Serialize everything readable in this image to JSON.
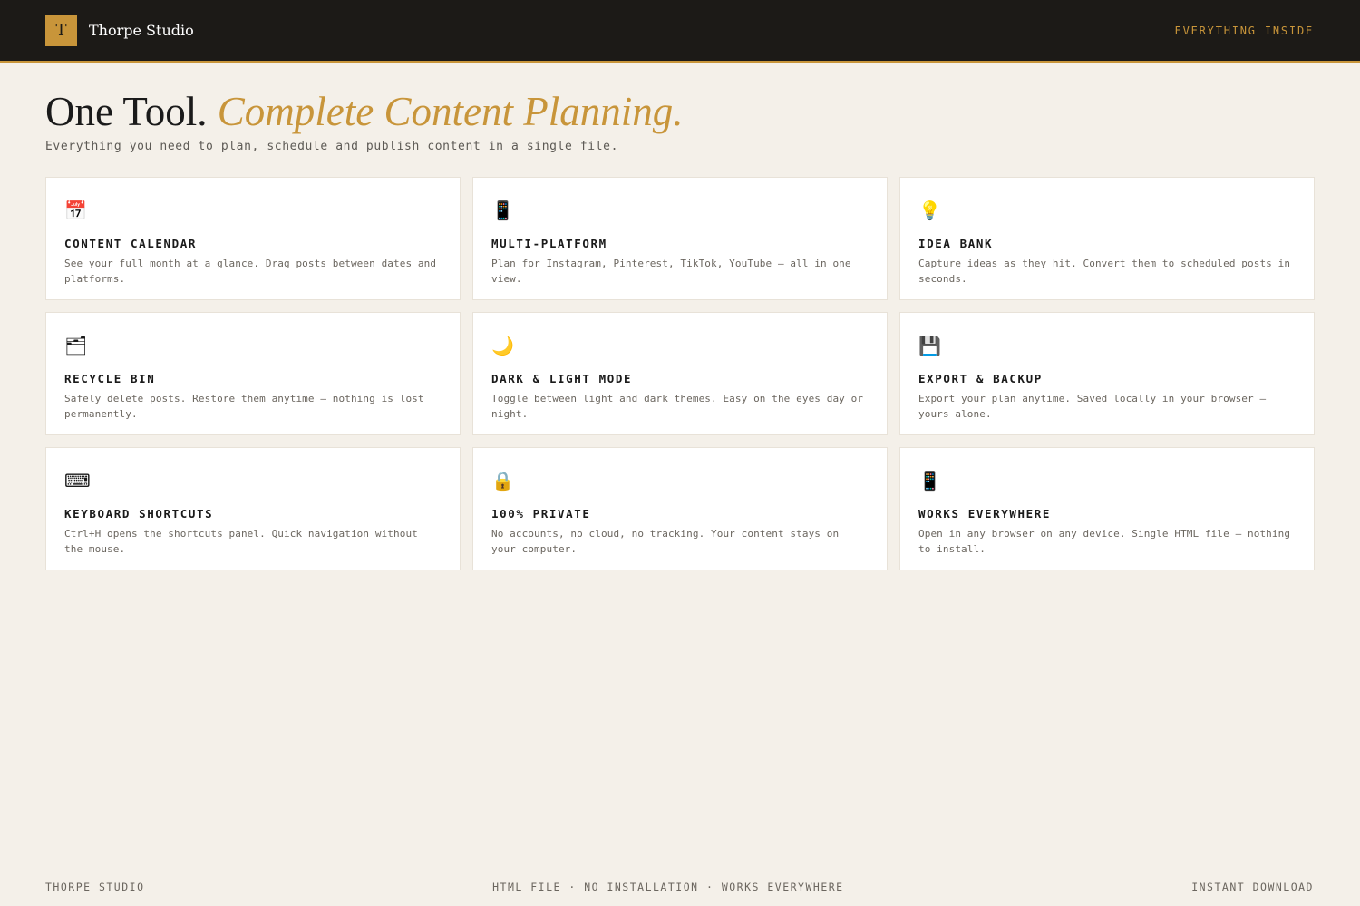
{
  "header": {
    "logo_letter": "T",
    "brand": "Thorpe Studio",
    "nav_link": "EVERYTHING INSIDE"
  },
  "hero": {
    "title_main": "One Tool.",
    "title_accent": "Complete Content Planning.",
    "subtitle": "Everything you need to plan, schedule and publish content in a single file."
  },
  "features": [
    {
      "icon": "calendar-icon",
      "glyph": "📅",
      "title": "CONTENT CALENDAR",
      "desc": "See your full month at a glance. Drag posts between dates and platforms."
    },
    {
      "icon": "phone-icon",
      "glyph": "📱",
      "title": "MULTI-PLATFORM",
      "desc": "Plan for Instagram, Pinterest, TikTok, YouTube — all in one view."
    },
    {
      "icon": "lightbulb-icon",
      "glyph": "💡",
      "title": "IDEA BANK",
      "desc": "Capture ideas as they hit. Convert them to scheduled posts in seconds."
    },
    {
      "icon": "folder-icon",
      "glyph": "🗂",
      "title": "RECYCLE BIN",
      "desc": "Safely delete posts. Restore them anytime — nothing is lost permanently."
    },
    {
      "icon": "moon-icon",
      "glyph": "🌙",
      "title": "DARK & LIGHT MODE",
      "desc": "Toggle between light and dark themes. Easy on the eyes day or night."
    },
    {
      "icon": "floppy-disk-icon",
      "glyph": "💾",
      "title": "EXPORT & BACKUP",
      "desc": "Export your plan anytime. Saved locally in your browser — yours alone."
    },
    {
      "icon": "keyboard-icon",
      "glyph": "⌨",
      "title": "KEYBOARD SHORTCUTS",
      "desc": "Ctrl+H opens the shortcuts panel. Quick navigation without the mouse."
    },
    {
      "icon": "lock-icon",
      "glyph": "🔒",
      "title": "100% PRIVATE",
      "desc": "No accounts, no cloud, no tracking. Your content stays on your computer."
    },
    {
      "icon": "phone-icon",
      "glyph": "📱",
      "title": "WORKS EVERYWHERE",
      "desc": "Open in any browser on any device. Single HTML file — nothing to install."
    }
  ],
  "footer": {
    "left": "THORPE STUDIO",
    "center": "HTML FILE · NO INSTALLATION · WORKS EVERYWHERE",
    "right": "INSTANT DOWNLOAD"
  },
  "colors": {
    "accent": "#c8953a",
    "header_bg": "#1c1a17",
    "page_bg": "#f4f0e9"
  }
}
